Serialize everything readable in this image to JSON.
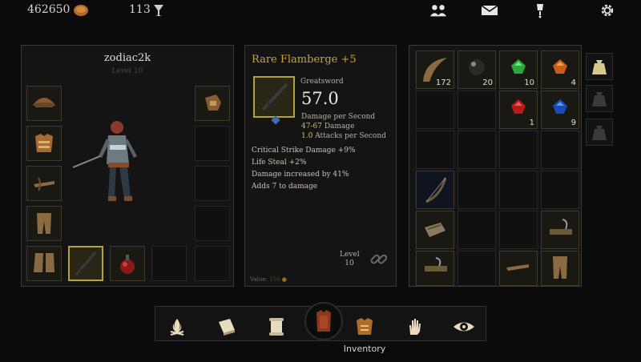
{
  "topbar": {
    "gold": "462650",
    "gems": "113",
    "icons": [
      "coin-icon",
      "goblet-icon",
      "friends-icon",
      "mail-icon",
      "notification-icon",
      "gear-icon"
    ]
  },
  "character": {
    "name": "zodiac2k",
    "level": "Level 10"
  },
  "item": {
    "name": "Rare Flamberge +5",
    "type": "Greatsword",
    "dps": "57.0",
    "dps_label": "Damage per Second",
    "damage_range": "47-67",
    "damage_label": "Damage",
    "attacks": "1.0",
    "attacks_label": "Attacks per Second",
    "stats": [
      "Critical Strike Damage +9%",
      "Life Steal +2%",
      "Damage increased by 41%",
      "Adds 7 to damage"
    ],
    "level_label": "Level",
    "level_value": "10",
    "value_label": "Value:",
    "value_amount": "156"
  },
  "inventory": {
    "counts": [
      "172",
      "20",
      "10",
      "4",
      "1",
      "9"
    ]
  },
  "nav": {
    "active_label": "Inventory",
    "buttons": [
      "campfire-icon",
      "book-icon",
      "scroll-icon",
      "armor-icon",
      "chest-armor-icon",
      "hand-icon",
      "eye-icon"
    ]
  },
  "colors": {
    "accent_gold": "#b5a23a",
    "item_name": "#c9a43a",
    "panel_border": "#3a3a3a"
  }
}
